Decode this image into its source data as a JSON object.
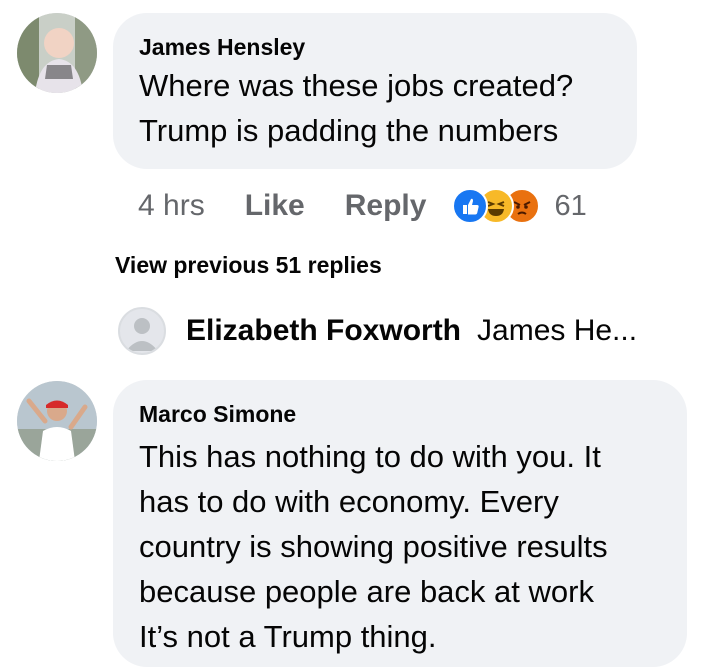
{
  "comment1": {
    "author": "James Hensley",
    "text": "Where was these jobs created?\nTrump is padding the numbers",
    "time": "4 hrs",
    "like_label": "Like",
    "reply_label": "Reply",
    "reaction_count": "61",
    "reaction_icons": [
      "like-reaction-icon",
      "haha-reaction-icon",
      "angry-reaction-icon"
    ]
  },
  "view_previous_label": "View previous 51 replies",
  "reply_preview": {
    "author": "Elizabeth Foxworth",
    "snippet": "James He..."
  },
  "comment2": {
    "author": "Marco Simone",
    "text": "This has nothing to do with you.  It\nhas to do with economy.  Every\ncountry is showing positive results\nbecause people are back at work\nIt’s not a Trump thing."
  },
  "colors": {
    "bubble_bg": "#f0f2f5",
    "meta_text": "#65676b",
    "like_blue": "#1877f2",
    "haha_yellow": "#f7b928",
    "angry_orange": "#e9710f"
  }
}
